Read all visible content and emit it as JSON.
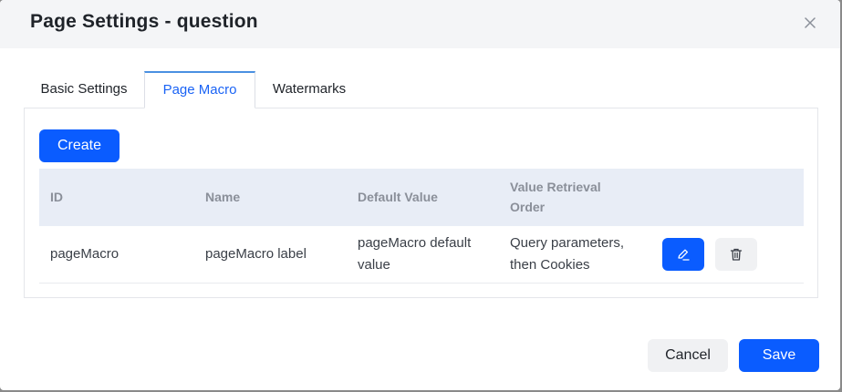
{
  "dialog": {
    "title": "Page Settings - question",
    "close_icon": "close-icon"
  },
  "tabs": [
    {
      "label": "Basic Settings",
      "active": false
    },
    {
      "label": "Page Macro",
      "active": true
    },
    {
      "label": "Watermarks",
      "active": false
    }
  ],
  "panel": {
    "create_label": "Create",
    "columns": [
      "ID",
      "Name",
      "Default Value",
      "Value Retrieval Order"
    ],
    "rows": [
      {
        "id": "pageMacro",
        "name": "pageMacro label",
        "default_value": "pageMacro default value",
        "retrieval_order": "Query parameters, then Cookies",
        "edit_icon": "edit-icon",
        "delete_icon": "trash-icon"
      }
    ]
  },
  "footer": {
    "cancel_label": "Cancel",
    "save_label": "Save"
  },
  "colors": {
    "primary": "#0a5cff",
    "active_tab_text": "#1a63f5",
    "header_bg": "#f4f5f7",
    "table_header_bg": "#e8edf6"
  }
}
